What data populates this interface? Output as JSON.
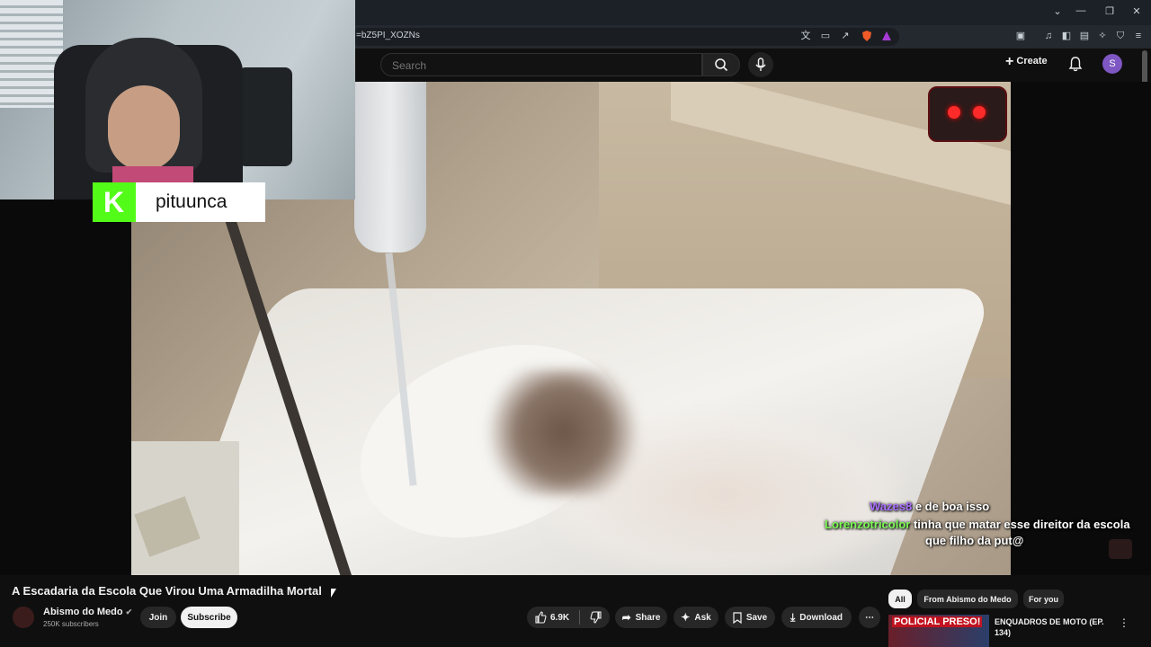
{
  "browser": {
    "url": "=bZ5PI_XOZNs",
    "window_controls": [
      "chevron-down-icon",
      "minimize-icon",
      "restore-icon",
      "close-icon"
    ]
  },
  "header": {
    "search_placeholder": "Search",
    "create_label": "Create",
    "avatar_letter": "S"
  },
  "streamer": {
    "platform": "kick",
    "logo_letter": "K",
    "name": "pituunca"
  },
  "chat": [
    {
      "user": "Wazes8",
      "user_color": "#a970ff",
      "message": "e de boa isso"
    },
    {
      "user": "Lorenzotricolor",
      "user_color": "#7cfc55",
      "message": "tinha que matar esse direitor da escola"
    },
    {
      "user": "",
      "user_color": "#ffffff",
      "message": "que filho da put@"
    }
  ],
  "video": {
    "title": "A Escadaria da Escola Que Virou Uma Armadilha Mortal",
    "channel": "Abismo do Medo",
    "subscribers": "250K subscribers",
    "join_label": "Join",
    "subscribe_label": "Subscribe",
    "likes": "6.9K",
    "share_label": "Share",
    "ask_label": "Ask",
    "save_label": "Save",
    "download_label": "Download"
  },
  "chips": [
    "All",
    "From Abismo do Medo",
    "For you"
  ],
  "recommendation": {
    "thumb_text": "POLICIAL PRESO!",
    "title": "ENQUADROS DE MOTO (EP. 134)"
  },
  "colors": {
    "background": "#0f0f0f",
    "kick_green": "#53fc18",
    "avatar_purple": "#7e57c2"
  }
}
